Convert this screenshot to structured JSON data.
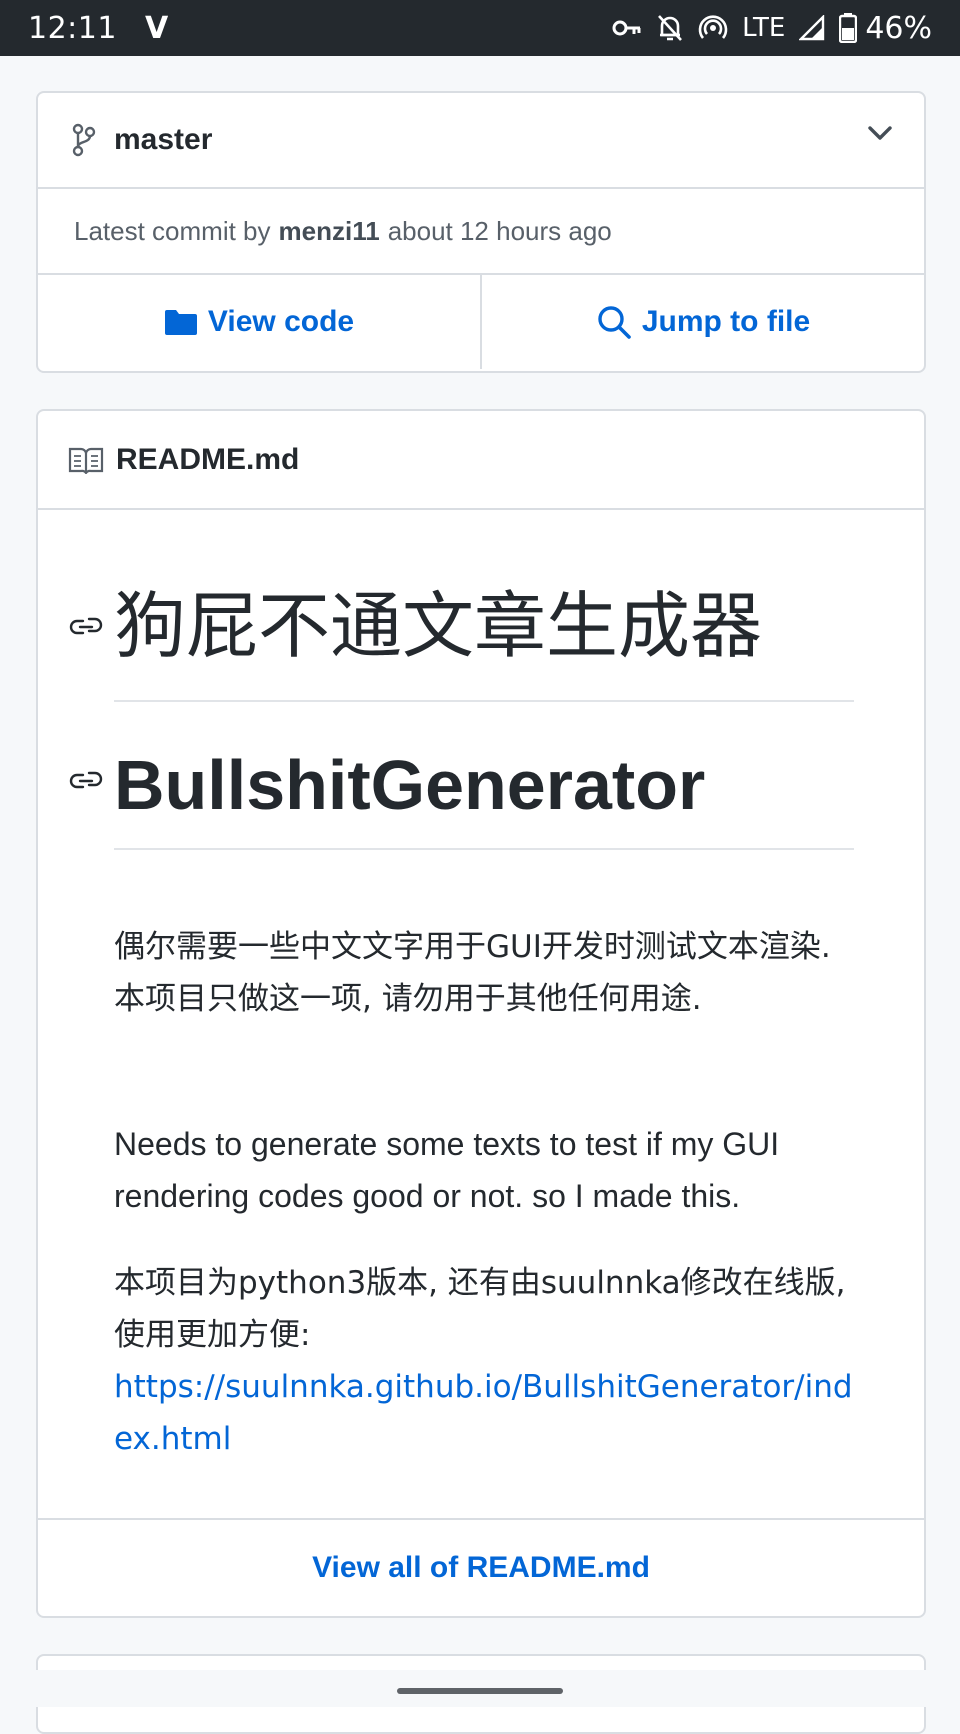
{
  "status_bar": {
    "time": "12:11",
    "app_icon": "V",
    "network": "LTE",
    "battery": "46%",
    "icons": [
      "key-icon",
      "bell-off-icon",
      "hotspot-icon",
      "signal-icon",
      "battery-icon"
    ]
  },
  "branch": {
    "name": "master",
    "commit_prefix": "Latest commit by",
    "commit_author": "menzi11",
    "commit_time": "about 12 hours ago",
    "view_code_label": "View code",
    "jump_label": "Jump to file"
  },
  "readme": {
    "file_name": "README.md",
    "heading_cn": "狗屁不通文章生成器",
    "heading_en": "BullshitGenerator",
    "para1": "偶尔需要一些中文文字用于GUI开发时测试文本渲染. 本项目只做这一项, 请勿用于其他任何用途.",
    "para2": "Needs to generate some texts to test if my GUI rendering codes good or not. so I made this.",
    "para3": "本项目为python3版本, 还有由suulnnka修改在线版, 使用更加方便:",
    "link": "https://suulnnka.github.io/BullshitGenerator/index.html",
    "view_all_label": "View all of README.md"
  },
  "colors": {
    "link": "#0366d6",
    "status_bar_bg": "#24292e",
    "page_bg": "#f6f8fa",
    "border": "#d9dde2"
  }
}
